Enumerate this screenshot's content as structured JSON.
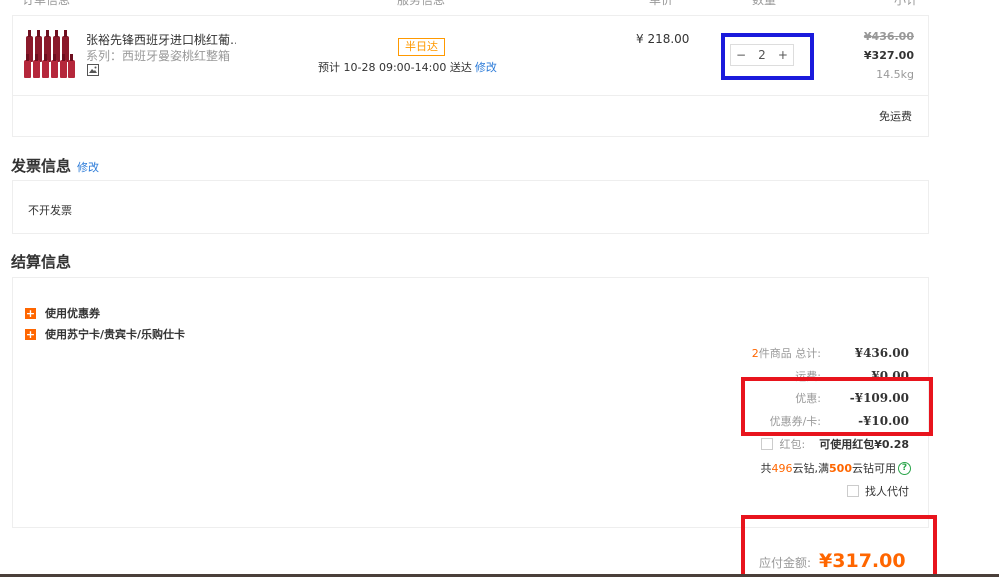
{
  "header": {
    "columns": [
      "订单信息",
      "服务信息",
      "单价",
      "数量",
      "小计"
    ]
  },
  "product": {
    "name": "张裕先锋西班牙进口桃红葡…",
    "series": "系列：西班牙曼姿桃红整箱",
    "image_icon": "image-icon",
    "service_badge": "半日达",
    "eta_text": "预计 10-28 09:00-14:00 送达",
    "eta_edit": "修改",
    "unit_price": "¥ 218.00",
    "quantity": "2",
    "minus": "−",
    "plus": "+",
    "old_total": "¥436.00",
    "new_total": "¥327.00",
    "weight": "14.5kg",
    "freight": "免运费"
  },
  "invoice": {
    "title": "发票信息",
    "edit": "修改",
    "value": "不开发票"
  },
  "settlement": {
    "title": "结算信息",
    "options": [
      "使用优惠券",
      "使用苏宁卡/贵宾卡/乐购仕卡"
    ],
    "count_prefix": "2",
    "count_label": "件商品 总计:",
    "total": "¥436.00",
    "shipping_label": "运费:",
    "shipping": "¥0.00",
    "discount_label": "优惠:",
    "discount": "-¥109.00",
    "coupon_label": "优惠券/卡:",
    "coupon": "-¥10.00",
    "redpacket_label": "红包:",
    "redpacket_value": "可使用红包¥0.28",
    "diamond_prefix": "共",
    "diamond_count": "496",
    "diamond_mid": "云钻,满",
    "diamond_threshold": "500",
    "diamond_suffix": "云钻可用",
    "proxy_pay": "找人代付",
    "pay_label": "应付金额:",
    "pay_value": "¥317.00"
  },
  "colors": {
    "accent": "#ff6600",
    "link": "#2a7ad8",
    "highlight_red": "#e8141d",
    "highlight_blue": "#1a1adc"
  }
}
